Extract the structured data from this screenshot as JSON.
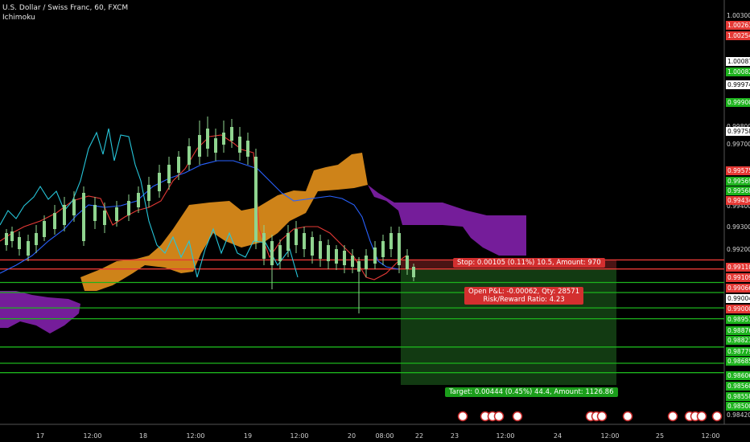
{
  "header": {
    "symbol_line": "U.S. Dollar / Swiss Franc, 60, FXCM",
    "indicator": "Ichimoku"
  },
  "colors": {
    "background": "#000000",
    "kijun_red": "#e53935",
    "tenkan_blue": "#2962ff",
    "chikou_cyan": "#26c6da",
    "candle_up": "#8fd48f",
    "cloud_bull": "#d98a1a",
    "cloud_bear": "#7b1fa2",
    "stop_zone": "#4a1414",
    "target_zone": "#123a12"
  },
  "chart_data": {
    "type": "candlestick",
    "instrument": "USDCHF",
    "timeframe": "60",
    "ylim": [
      0.9842,
      1.003
    ],
    "x_ticks": [
      "17",
      "12:00",
      "18",
      "12:00",
      "19",
      "12:00",
      "20",
      "08:00",
      "22",
      "23",
      "12:00",
      "24",
      "12:00",
      "25",
      "12:00"
    ],
    "y_ticks": [
      "1.00300",
      "0.99800",
      "0.99700",
      "0.99400",
      "0.99300",
      "0.99200",
      "0.98420"
    ],
    "price_labels": [
      {
        "text": "1.00263",
        "color": "#e53935"
      },
      {
        "text": "1.00254",
        "color": "#e53935"
      },
      {
        "text": "1.00087",
        "color": "#ffffff"
      },
      {
        "text": "1.00082",
        "color": "#1db31d"
      },
      {
        "text": "0.99974",
        "color": "#ffffff"
      },
      {
        "text": "0.99900",
        "color": "#1db31d"
      },
      {
        "text": "0.99758",
        "color": "#ffffff"
      },
      {
        "text": "0.99575",
        "color": "#e53935"
      },
      {
        "text": "0.99569",
        "color": "#1db31d"
      },
      {
        "text": "0.99568",
        "color": "#1db31d"
      },
      {
        "text": "0.99434",
        "color": "#e53935"
      },
      {
        "text": "0.99110",
        "color": "#e53935"
      },
      {
        "text": "0.99109",
        "color": "#e53935"
      },
      {
        "text": "0.99066",
        "color": "#e53935"
      },
      {
        "text": "0.99004",
        "color": "#ffffff"
      },
      {
        "text": "0.99000",
        "color": "#e53935"
      },
      {
        "text": "0.98951",
        "color": "#1db31d"
      },
      {
        "text": "0.98876",
        "color": "#1db31d"
      },
      {
        "text": "0.98823",
        "color": "#1db31d"
      },
      {
        "text": "0.98779",
        "color": "#1db31d"
      },
      {
        "text": "0.98685",
        "color": "#1db31d"
      },
      {
        "text": "0.98606",
        "color": "#1db31d"
      },
      {
        "text": "0.98560",
        "color": "#1db31d"
      },
      {
        "text": "0.98558",
        "color": "#1db31d"
      },
      {
        "text": "0.98500",
        "color": "#1db31d"
      }
    ],
    "horizontal_levels": [
      {
        "price": 0.9911,
        "color": "#e53935"
      },
      {
        "price": 0.99066,
        "color": "#e53935"
      },
      {
        "price": 0.99,
        "color": "#1db31d"
      },
      {
        "price": 0.98951,
        "color": "#1db31d"
      },
      {
        "price": 0.98876,
        "color": "#1db31d"
      },
      {
        "price": 0.98823,
        "color": "#1db31d"
      },
      {
        "price": 0.98685,
        "color": "#1db31d"
      },
      {
        "price": 0.98606,
        "color": "#1db31d"
      },
      {
        "price": 0.9856,
        "color": "#1db31d"
      }
    ],
    "position": {
      "stop_text": "Stop: 0.00105 (0.11%) 10.5, Amount: 970",
      "pnl_text": "Open P&L: -0.00062, Qty: 28571",
      "rr_text": "Risk/Reward Ratio: 4.23",
      "target_text": "Target: 0.00444 (0.45%) 44.4, Amount: 1126.86"
    }
  }
}
